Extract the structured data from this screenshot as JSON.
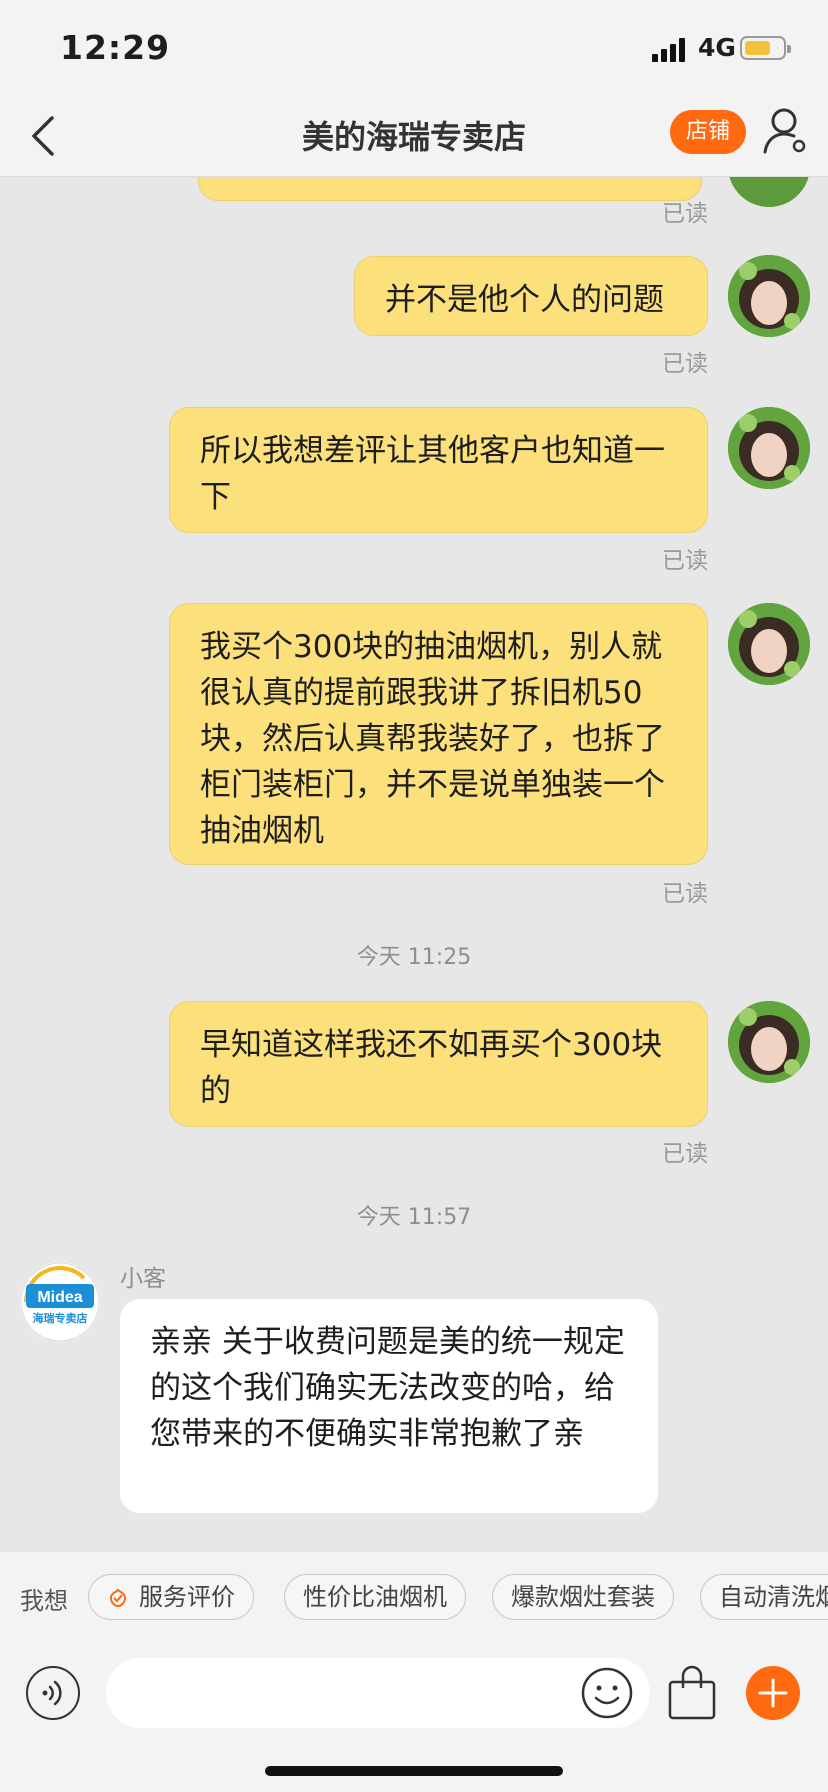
{
  "status_bar": {
    "time": "12:29",
    "network": "4G"
  },
  "nav": {
    "title": "美的海瑞专卖店",
    "shop_button": "店铺"
  },
  "messages": [
    {
      "read_label": "已读"
    },
    {
      "text": "并不是他个人的问题",
      "read_label": "已读"
    },
    {
      "text": "所以我想差评让其他客户也知道一下",
      "read_label": "已读"
    },
    {
      "text": "我买个300块的抽油烟机，别人就很认真的提前跟我讲了拆旧机50块，然后认真帮我装好了，也拆了柜门装柜门，并不是说单独装一个抽油烟机",
      "read_label": "已读"
    },
    {
      "timestamp": "今天 11:25"
    },
    {
      "text": "早知道这样我还不如再买个300块的",
      "read_label": "已读"
    },
    {
      "timestamp": "今天 11:57"
    },
    {
      "sender": "小客",
      "text": "亲亲  关于收费问题是美的统一规定的这个我们确实无法改变的哈，给您带来的不便确实非常抱歉了亲",
      "avatar_brand": "Midea",
      "avatar_store": "海瑞专卖店"
    }
  ],
  "suggestions": {
    "label": "我想",
    "chips": [
      "服务评价",
      "性价比油烟机",
      "爆款烟灶套装",
      "自动清洗烟"
    ]
  },
  "colors": {
    "accent": "#ff6a10",
    "outgoing_bubble": "#fbe07c",
    "incoming_bubble": "#ffffff",
    "battery": "#f5c23b"
  },
  "icons": [
    "back-arrow-icon",
    "user-settings-icon",
    "voice-icon",
    "emoji-icon",
    "shopping-bag-icon",
    "plus-icon",
    "service-review-icon"
  ]
}
